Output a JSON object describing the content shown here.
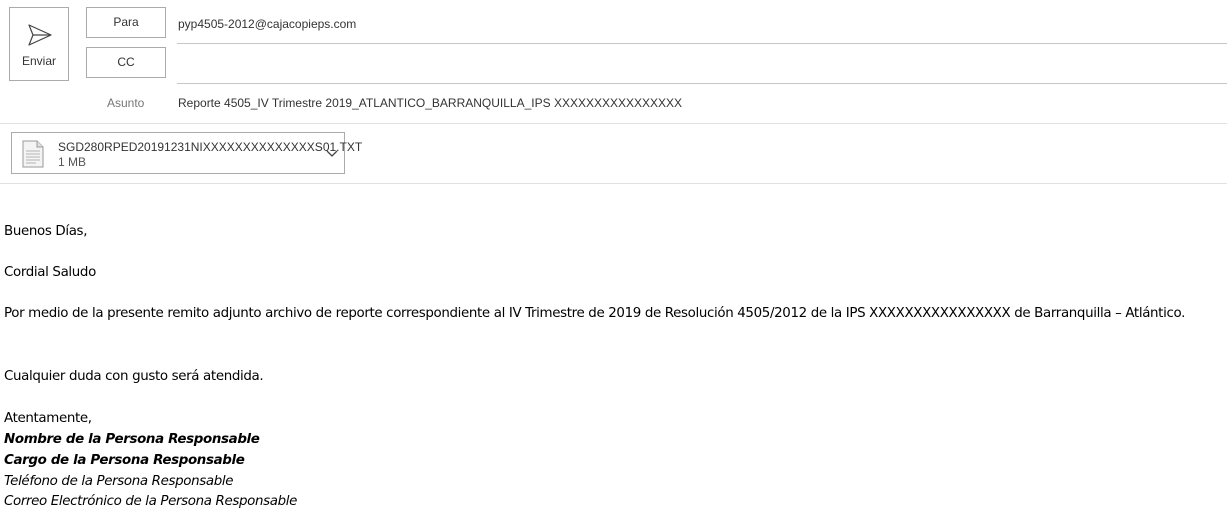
{
  "header": {
    "send_label": "Enviar",
    "to_label": "Para",
    "cc_label": "CC",
    "to_value": "pyp4505-2012@cajacopieps.com",
    "cc_value": "",
    "subject_label": "Asunto",
    "subject_value": "Reporte 4505_IV Trimestre 2019_ATLANTICO_BARRANQUILLA_IPS XXXXXXXXXXXXXXXX"
  },
  "attachment": {
    "name": "SGD280RPED20191231NIXXXXXXXXXXXXXXS01.TXT",
    "size": "1 MB",
    "icon": "text-file-icon"
  },
  "body": {
    "greeting": "Buenos Días,",
    "salutation": "Cordial Saludo",
    "paragraph": "Por medio de la presente remito adjunto archivo de reporte correspondiente al IV Trimestre de 2019 de Resolución 4505/2012 de la IPS  XXXXXXXXXXXXXXXX de Barranquilla – Atlántico.",
    "questions": "Cualquier duda con gusto será atendida.",
    "closing": "Atentamente,",
    "signature_name": "Nombre de la Persona Responsable",
    "signature_title": "Cargo de la Persona Responsable",
    "signature_phone": "Teléfono de la Persona Responsable",
    "signature_email": "Correo Electrónico de la Persona Responsable"
  }
}
